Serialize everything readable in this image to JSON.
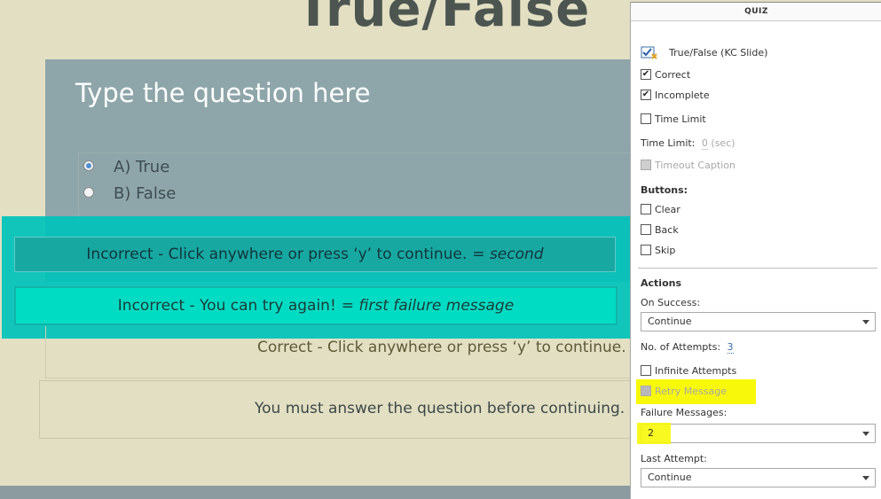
{
  "slide": {
    "title": "True/False",
    "question": "Type the question here",
    "answers": [
      {
        "label": "A) True",
        "selected": true
      },
      {
        "label": "B) False",
        "selected": false
      }
    ],
    "captions": {
      "second_main": "Incorrect - Click anywhere or press ‘y’ to continue.",
      "second_note": "= second",
      "first_main": "Incorrect - You can try again!",
      "first_note": "= first failure message",
      "correct": "Correct - Click anywhere or press ‘y’ to continue.",
      "incomplete": "You must answer the question before continuing."
    }
  },
  "panel": {
    "header": "QUIZ",
    "slide_type": "True/False (KC Slide)",
    "correct_label": "Correct",
    "correct_checked": true,
    "incomplete_label": "Incomplete",
    "incomplete_checked": true,
    "time_limit_label": "Time Limit",
    "time_limit_checked": false,
    "time_limit_field_label": "Time Limit:",
    "time_limit_value": "0",
    "time_limit_unit": "(sec)",
    "timeout_caption_label": "Timeout Caption",
    "buttons_label": "Buttons:",
    "clear_label": "Clear",
    "back_label": "Back",
    "skip_label": "Skip",
    "actions_label": "Actions",
    "on_success_label": "On Success:",
    "on_success_value": "Continue",
    "attempts_label": "No. of Attempts:",
    "attempts_value": "3",
    "infinite_label": "Infinite Attempts",
    "retry_label": "Retry Message",
    "failure_messages_label": "Failure Messages:",
    "failure_messages_value": "2",
    "last_attempt_label": "Last Attempt:",
    "last_attempt_value": "Continue"
  },
  "colors": {
    "highlight_band": "#00c2ba",
    "marker_yellow": "#f8f80a",
    "question_box": "#8ea6aa"
  }
}
